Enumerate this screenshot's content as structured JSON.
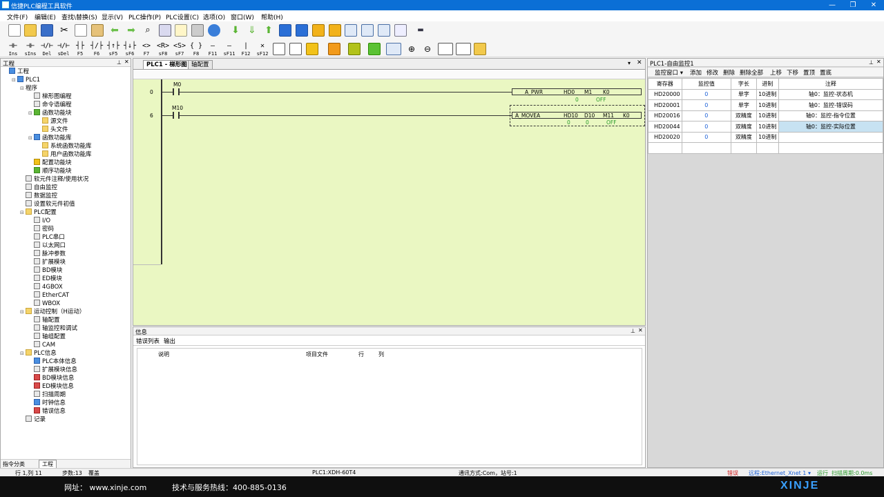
{
  "window": {
    "title": "信捷PLC编程工具软件",
    "controls": [
      "—",
      "❐",
      "✕"
    ]
  },
  "menu": [
    "文件(F)",
    "编辑(E)",
    "查找\\替换(S)",
    "显示(V)",
    "PLC操作(P)",
    "PLC设置(C)",
    "选项(O)",
    "窗口(W)",
    "帮助(H)"
  ],
  "toolbar2": [
    {
      "sym": "⊣⊢",
      "label": "Ins"
    },
    {
      "sym": "⊣⊢",
      "label": "sIns"
    },
    {
      "sym": "⊣/⊢",
      "label": "Del"
    },
    {
      "sym": "⊣/⊢",
      "label": "sDel"
    },
    {
      "sym": "┤├",
      "label": "F5"
    },
    {
      "sym": "┤/├",
      "label": "F6"
    },
    {
      "sym": "┤↑├",
      "label": "sF5"
    },
    {
      "sym": "┤↓├",
      "label": "sF6"
    },
    {
      "sym": "<>",
      "label": "F7"
    },
    {
      "sym": "<R>",
      "label": "sF8"
    },
    {
      "sym": "<S>",
      "label": "sF7"
    },
    {
      "sym": "{ }",
      "label": "F8"
    },
    {
      "sym": "—",
      "label": "F11"
    },
    {
      "sym": "—",
      "label": "sF11"
    },
    {
      "sym": "|",
      "label": "F12"
    },
    {
      "sym": "✕",
      "label": "sF12"
    }
  ],
  "project": {
    "title": "工程",
    "tree": [
      {
        "label": "工程",
        "depth": 0,
        "icon": "blue",
        "tog": ""
      },
      {
        "label": "PLC1",
        "depth": 1,
        "icon": "blue",
        "tog": "⊟"
      },
      {
        "label": "程序",
        "depth": 2,
        "icon": "none",
        "tog": "⊟"
      },
      {
        "label": "梯形图编程",
        "depth": 3,
        "icon": "",
        "tog": ""
      },
      {
        "label": "命令语编程",
        "depth": 3,
        "icon": "",
        "tog": ""
      },
      {
        "label": "函数功能块",
        "depth": 3,
        "icon": "green",
        "tog": "⊟"
      },
      {
        "label": "源文件",
        "depth": 4,
        "icon": "folder",
        "tog": ""
      },
      {
        "label": "头文件",
        "depth": 4,
        "icon": "folder",
        "tog": ""
      },
      {
        "label": "函数功能库",
        "depth": 3,
        "icon": "blue",
        "tog": "⊟"
      },
      {
        "label": "系统函数功能库",
        "depth": 4,
        "icon": "folder",
        "tog": ""
      },
      {
        "label": "用户函数功能库",
        "depth": 4,
        "icon": "folder",
        "tog": ""
      },
      {
        "label": "配置功能块",
        "depth": 3,
        "icon": "yellow",
        "tog": ""
      },
      {
        "label": "顺序功能块",
        "depth": 3,
        "icon": "green",
        "tog": ""
      },
      {
        "label": "软元件注释/使用状况",
        "depth": 2,
        "icon": "",
        "tog": ""
      },
      {
        "label": "自由监控",
        "depth": 2,
        "icon": "",
        "tog": ""
      },
      {
        "label": "数据监控",
        "depth": 2,
        "icon": "",
        "tog": ""
      },
      {
        "label": "设置软元件初值",
        "depth": 2,
        "icon": "",
        "tog": ""
      },
      {
        "label": "PLC配置",
        "depth": 2,
        "icon": "folder",
        "tog": "⊟"
      },
      {
        "label": "I/O",
        "depth": 3,
        "icon": "",
        "tog": ""
      },
      {
        "label": "密码",
        "depth": 3,
        "icon": "",
        "tog": ""
      },
      {
        "label": "PLC串口",
        "depth": 3,
        "icon": "",
        "tog": ""
      },
      {
        "label": "以太网口",
        "depth": 3,
        "icon": "",
        "tog": ""
      },
      {
        "label": "脉冲参数",
        "depth": 3,
        "icon": "",
        "tog": ""
      },
      {
        "label": "扩展模块",
        "depth": 3,
        "icon": "",
        "tog": ""
      },
      {
        "label": "BD模块",
        "depth": 3,
        "icon": "",
        "tog": ""
      },
      {
        "label": "ED模块",
        "depth": 3,
        "icon": "",
        "tog": ""
      },
      {
        "label": "4GBOX",
        "depth": 3,
        "icon": "",
        "tog": ""
      },
      {
        "label": "EtherCAT",
        "depth": 3,
        "icon": "",
        "tog": ""
      },
      {
        "label": "WBOX",
        "depth": 3,
        "icon": "",
        "tog": ""
      },
      {
        "label": "运动控制（H运动）",
        "depth": 2,
        "icon": "folder",
        "tog": "⊟"
      },
      {
        "label": "轴配置",
        "depth": 3,
        "icon": "",
        "tog": ""
      },
      {
        "label": "轴监控和调试",
        "depth": 3,
        "icon": "",
        "tog": ""
      },
      {
        "label": "轴组配置",
        "depth": 3,
        "icon": "",
        "tog": ""
      },
      {
        "label": "CAM",
        "depth": 3,
        "icon": "",
        "tog": ""
      },
      {
        "label": "PLC信息",
        "depth": 2,
        "icon": "folder",
        "tog": "⊟"
      },
      {
        "label": "PLC本体信息",
        "depth": 3,
        "icon": "blue",
        "tog": ""
      },
      {
        "label": "扩展模块信息",
        "depth": 3,
        "icon": "",
        "tog": ""
      },
      {
        "label": "BD模块信息",
        "depth": 3,
        "icon": "red",
        "tog": ""
      },
      {
        "label": "ED模块信息",
        "depth": 3,
        "icon": "red",
        "tog": ""
      },
      {
        "label": "扫描周期",
        "depth": 3,
        "icon": "",
        "tog": ""
      },
      {
        "label": "时钟信息",
        "depth": 3,
        "icon": "blue",
        "tog": ""
      },
      {
        "label": "错误信息",
        "depth": 3,
        "icon": "red",
        "tog": ""
      },
      {
        "label": "记录",
        "depth": 2,
        "icon": "",
        "tog": ""
      }
    ],
    "bottom_tabs": [
      "指令分类",
      "工程"
    ]
  },
  "ladder": {
    "tabs": [
      "PLC1 - 梯形图",
      "轴配置"
    ],
    "rung0": {
      "step": "0",
      "contact": "M0",
      "instr": "A_PWR",
      "p1": "HD0",
      "p2": "M1",
      "p3": "K0",
      "v1": "0",
      "v2": "OFF"
    },
    "rung1": {
      "step": "6",
      "contact": "M10",
      "instr": "A_MOVEA",
      "p1": "HD10",
      "p2": "D10",
      "p3": "M11",
      "p4": "K0",
      "v1": "0",
      "v2": "0",
      "v3": "OFF"
    }
  },
  "monitor": {
    "title": "PLC1-自由监控1",
    "toolbar": [
      "监控窗口 ▾",
      "添加",
      "修改",
      "删除",
      "删除全部",
      "上移",
      "下移",
      "置顶",
      "置底"
    ],
    "columns": [
      "寄存器",
      "监控值",
      "字长",
      "进制",
      "注释"
    ],
    "rows": [
      {
        "reg": "HD20000",
        "val": "0",
        "len": "单字",
        "base": "10进制",
        "note": "轴0：监控-状态机"
      },
      {
        "reg": "HD20001",
        "val": "0",
        "len": "单字",
        "base": "10进制",
        "note": "轴0：监控-错误码"
      },
      {
        "reg": "HD20016",
        "val": "0",
        "len": "双精度",
        "base": "10进制",
        "note": "轴0：监控-指令位置"
      },
      {
        "reg": "HD20044",
        "val": "0",
        "len": "双精度",
        "base": "10进制",
        "note": "轴0：监控-实际位置"
      },
      {
        "reg": "HD20020",
        "val": "0",
        "len": "双精度",
        "base": "10进制",
        "note": ""
      },
      {
        "reg": "",
        "val": "",
        "len": "",
        "base": "",
        "note": ""
      }
    ]
  },
  "info": {
    "title": "信息",
    "tabs": [
      "错误列表",
      "输出"
    ],
    "columns": [
      "说明",
      "项目文件",
      "行",
      "列"
    ]
  },
  "status": {
    "pos": "行 1,列 11",
    "steps": "步数:13",
    "mode": "覆盖",
    "plc": "PLC1:XDH-60T4",
    "comm": "通讯方式:Com，站号:1",
    "err": "错误",
    "remote": "远程:Ethernet_Xnet 1 ▾",
    "run": "运行",
    "scan": "扫描周期:0.0ms"
  },
  "footer": {
    "site": "网址：  www.xinje.com",
    "hotline": "技术与服务热线：400-885-0136",
    "brand": "XINJE"
  },
  "colors": {
    "titlebar": "#0b6fd6",
    "ladder_bg": "#eaf7c2",
    "monitor_sel": "#c7e2f2",
    "brand": "#3aa0ff"
  }
}
